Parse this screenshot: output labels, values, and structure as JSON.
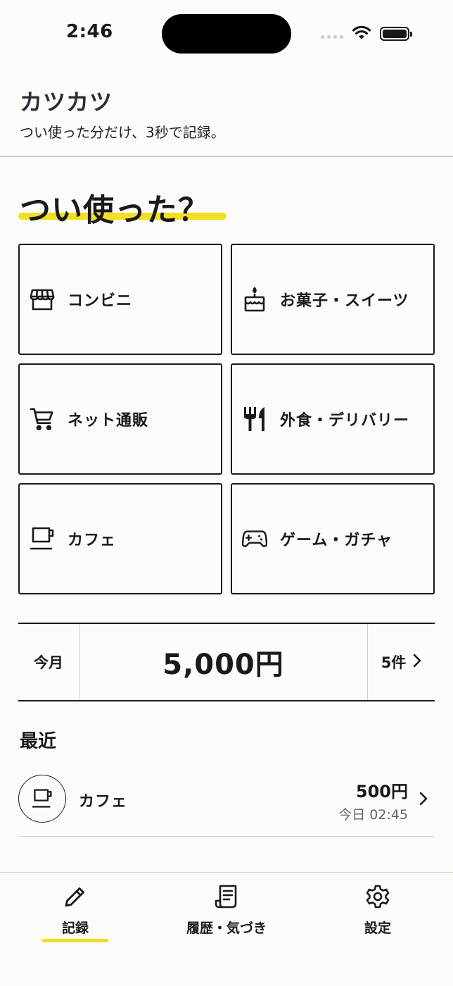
{
  "status_bar": {
    "time": "2:46"
  },
  "header": {
    "title": "カツカツ",
    "subtitle": "つい使った分だけ、3秒で記録。"
  },
  "section": {
    "heading": "つい使った？"
  },
  "categories": [
    {
      "label": "コンビニ",
      "icon": "store-icon"
    },
    {
      "label": "お菓子・スイーツ",
      "icon": "cake-icon"
    },
    {
      "label": "ネット通販",
      "icon": "cart-icon"
    },
    {
      "label": "外食・デリバリー",
      "icon": "utensils-icon"
    },
    {
      "label": "カフェ",
      "icon": "coffee-cup-icon"
    },
    {
      "label": "ゲーム・ガチャ",
      "icon": "gamepad-icon"
    }
  ],
  "summary": {
    "label": "今月",
    "amount": "5,000円",
    "count": "5件"
  },
  "recent": {
    "heading": "最近",
    "items": [
      {
        "name": "カフェ",
        "amount": "500円",
        "time": "今日 02:45",
        "icon": "coffee-cup-icon"
      }
    ]
  },
  "tabs": [
    {
      "label": "記録",
      "icon": "pencil-icon",
      "active": true
    },
    {
      "label": "履歴・気づき",
      "icon": "receipt-icon",
      "active": false
    },
    {
      "label": "設定",
      "icon": "gear-icon",
      "active": false
    }
  ],
  "colors": {
    "accent": "#f2df1f",
    "background": "#fdfcf9",
    "text": "#1a1a1a",
    "divider": "#cfd0da"
  }
}
